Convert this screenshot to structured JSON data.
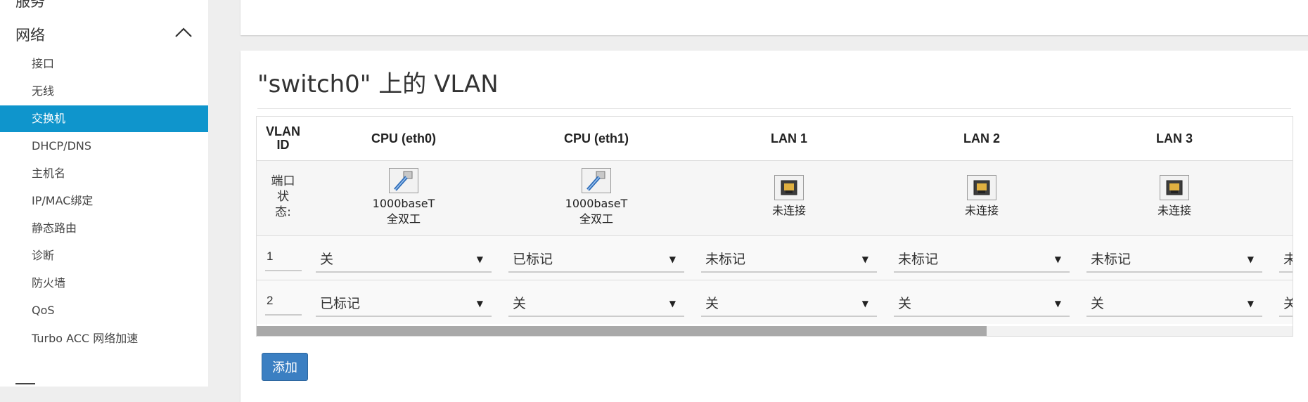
{
  "sidebar": {
    "top_item": "服务",
    "group": "网络",
    "items": [
      {
        "label": "接口"
      },
      {
        "label": "无线"
      },
      {
        "label": "交换机",
        "active": true
      },
      {
        "label": "DHCP/DNS"
      },
      {
        "label": "主机名"
      },
      {
        "label": "IP/MAC绑定"
      },
      {
        "label": "静态路由"
      },
      {
        "label": "诊断"
      },
      {
        "label": "防火墙"
      },
      {
        "label": "QoS"
      },
      {
        "label": "Turbo ACC 网络加速"
      }
    ]
  },
  "section": {
    "title": "\"switch0\" 上的 VLAN"
  },
  "table": {
    "vlan_header_line1": "VLAN",
    "vlan_header_line2": "ID",
    "status_label_lines": [
      "端口",
      "状",
      "态:"
    ],
    "ports": [
      {
        "name": "CPU (eth0)",
        "type": "cpu",
        "status_line1": "1000baseT",
        "status_line2": "全双工"
      },
      {
        "name": "CPU (eth1)",
        "type": "cpu",
        "status_line1": "1000baseT",
        "status_line2": "全双工"
      },
      {
        "name": "LAN 1",
        "type": "lan",
        "status_line1": "未连接"
      },
      {
        "name": "LAN 2",
        "type": "lan",
        "status_line1": "未连接"
      },
      {
        "name": "LAN 3",
        "type": "lan",
        "status_line1": "未连接"
      }
    ],
    "rows": [
      {
        "id": "1",
        "values": [
          "关",
          "已标记",
          "未标记",
          "未标记",
          "未标记"
        ],
        "overflow_value": "未"
      },
      {
        "id": "2",
        "values": [
          "已标记",
          "关",
          "关",
          "关",
          "关"
        ],
        "overflow_value": "关"
      }
    ],
    "scroll_fraction": 0.705
  },
  "actions": {
    "add_label": "添加"
  },
  "colors": {
    "accent": "#0f95cc",
    "button": "#3b7fc2"
  }
}
